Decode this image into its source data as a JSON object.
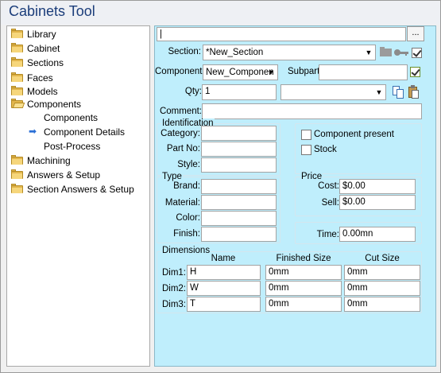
{
  "window": {
    "title": "Cabinets Tool"
  },
  "tree": {
    "items": [
      {
        "label": "Library",
        "icon": "folder-icon"
      },
      {
        "label": "Cabinet",
        "icon": "folder-icon"
      },
      {
        "label": "Sections",
        "icon": "folder-icon"
      },
      {
        "label": "Faces",
        "icon": "folder-icon"
      },
      {
        "label": "Models",
        "icon": "folder-icon"
      },
      {
        "label": "Components",
        "icon": "folder-open-icon"
      },
      {
        "label": "Components",
        "icon": ""
      },
      {
        "label": "Component Details",
        "icon": "arrow-right-icon"
      },
      {
        "label": "Post-Process",
        "icon": ""
      },
      {
        "label": "Machining",
        "icon": "folder-icon"
      },
      {
        "label": "Answers & Setup",
        "icon": "folder-icon"
      },
      {
        "label": "Section Answers & Setup",
        "icon": "folder-icon"
      }
    ],
    "selected": "Component Details"
  },
  "form": {
    "path": {
      "value": "|",
      "browse_label": "..."
    },
    "section": {
      "label": "Section:",
      "value": "*New_Section"
    },
    "component": {
      "label": "Component:",
      "value": "New_Componen"
    },
    "subpart": {
      "label": "Subpart",
      "value": ""
    },
    "qty": {
      "label": "Qty:",
      "value": "1",
      "dropdown_value": ""
    },
    "comment": {
      "label": "Comment:",
      "value": ""
    },
    "identification": {
      "title": "Identification",
      "category": {
        "label": "Category:",
        "value": ""
      },
      "part_no": {
        "label": "Part No:",
        "value": ""
      },
      "style": {
        "label": "Style:",
        "value": ""
      }
    },
    "flags": {
      "component_present": {
        "label": "Component present",
        "checked": false
      },
      "stock": {
        "label": "Stock",
        "checked": false
      }
    },
    "type": {
      "title": "Type",
      "brand": {
        "label": "Brand:",
        "value": ""
      },
      "material": {
        "label": "Material:",
        "value": ""
      },
      "color": {
        "label": "Color:",
        "value": ""
      },
      "finish": {
        "label": "Finish:",
        "value": ""
      }
    },
    "price": {
      "title": "Price",
      "cost": {
        "label": "Cost:",
        "value": "$0.00"
      },
      "sell": {
        "label": "Sell:",
        "value": "$0.00"
      }
    },
    "time": {
      "label": "Time:",
      "value": "0.00mn"
    },
    "dimensions": {
      "title": "Dimensions",
      "columns": [
        "Name",
        "Finished Size",
        "Cut Size"
      ],
      "rows": [
        {
          "label": "Dim1:",
          "name": "H",
          "finished": "0mm",
          "cut": "0mm"
        },
        {
          "label": "Dim2:",
          "name": "W",
          "finished": "0mm",
          "cut": "0mm"
        },
        {
          "label": "Dim3:",
          "name": "T",
          "finished": "0mm",
          "cut": "0mm"
        }
      ]
    }
  },
  "colors": {
    "panel_bg": "#bfeefc",
    "title_text": "#1b3d7a",
    "selection_arrow": "#2a6fd6"
  }
}
